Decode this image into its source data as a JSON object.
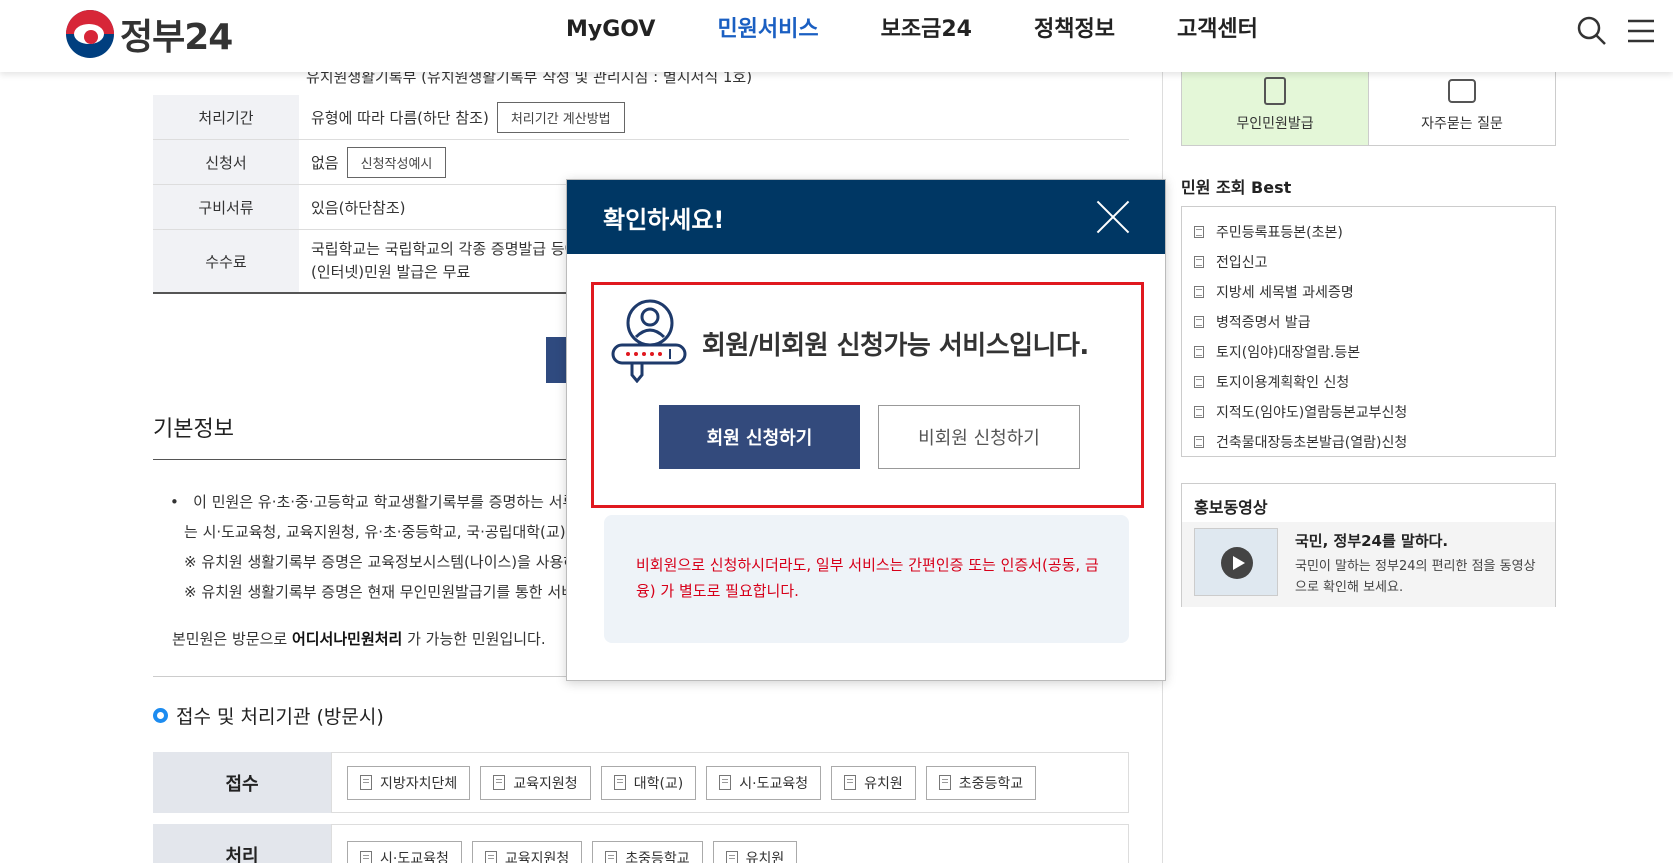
{
  "header": {
    "logo_text": "정부24",
    "nav": [
      "MyGOV",
      "민원서비스",
      "보조금24",
      "정책정보",
      "고객센터"
    ],
    "active_nav": "민원서비스"
  },
  "info_table": {
    "top_cut_text": "유치원생활기록부 (유치원생활기록부 작성 및 관리지침 : 별지서식 1호)",
    "rows": [
      {
        "label": "처리기간",
        "value": "유형에 따라 다름(하단 참조)",
        "button": "처리기간 계산방법"
      },
      {
        "label": "신청서",
        "value": "없음",
        "button": "신청작성예시"
      },
      {
        "label": "구비서류",
        "value": "있음(하단참조)"
      },
      {
        "label": "수수료",
        "value_line1": "국립학교는 국립학교의 각종 증명발급 등에",
        "value_line2": "(인터넷)민원 발급은 무료"
      }
    ]
  },
  "basic_info": {
    "title": "기본정보",
    "bullets": [
      "이 민원은 유·초·중·고등학교 학교생활기록부를 증명하는 서류",
      "는 시·도교육청, 교육지원청, 유·초·중등학교, 국·공립대학(교),",
      "※ 유치원 생활기록부 증명은 교육정보시스템(나이스)을 사용하",
      "※ 유치원 생활기록부 증명은 현재 무인민원발급기를 통한 서비"
    ],
    "note_prefix": "본민원은 방문으로 ",
    "note_bold": "어디서나민원처리",
    "note_suffix": " 가 가능한 민원입니다."
  },
  "agency": {
    "title": "접수 및 처리기관 (방문시)",
    "receive_label": "접수",
    "receive_chips": [
      "지방자치단체",
      "교육지원청",
      "대학(교)",
      "시·도교육청",
      "유치원",
      "초중등학교"
    ],
    "process_label": "처리",
    "process_chips": [
      "시·도교육청",
      "교육지원청",
      "초중등학교",
      "유치원"
    ]
  },
  "sidebar": {
    "quick": [
      "무인민원발급",
      "자주묻는 질문"
    ],
    "best_title": "민원 조회 Best",
    "best_items": [
      "주민등록표등본(초본)",
      "전입신고",
      "지방세 세목별 과세증명",
      "병적증명서 발급",
      "토지(임야)대장열람.등본",
      "토지이용계획확인 신청",
      "지적도(임야도)열람등본교부신청",
      "건축물대장등초본발급(열람)신청"
    ],
    "promo_title": "홍보동영상",
    "promo_heading": "국민, 정부24를 말하다.",
    "promo_desc": "국민이 말하는 정부24의 편리한 점을 동영상으로 확인해 보세요."
  },
  "modal": {
    "title": "확인하세요!",
    "message": "회원/비회원 신청가능 서비스입니다.",
    "member_button": "회원 신청하기",
    "guest_button": "비회원 신청하기",
    "notice": "비회원으로 신청하시더라도, 일부 서비스는 간편인증 또는 인증서(공동, 금융) 가 별도로 필요합니다."
  },
  "colors": {
    "modal_header": "#003764",
    "member_button": "#334a7c",
    "highlight_frame": "#e0181f",
    "notice_text": "#d7001a",
    "active_nav": "#1a5fc2"
  }
}
